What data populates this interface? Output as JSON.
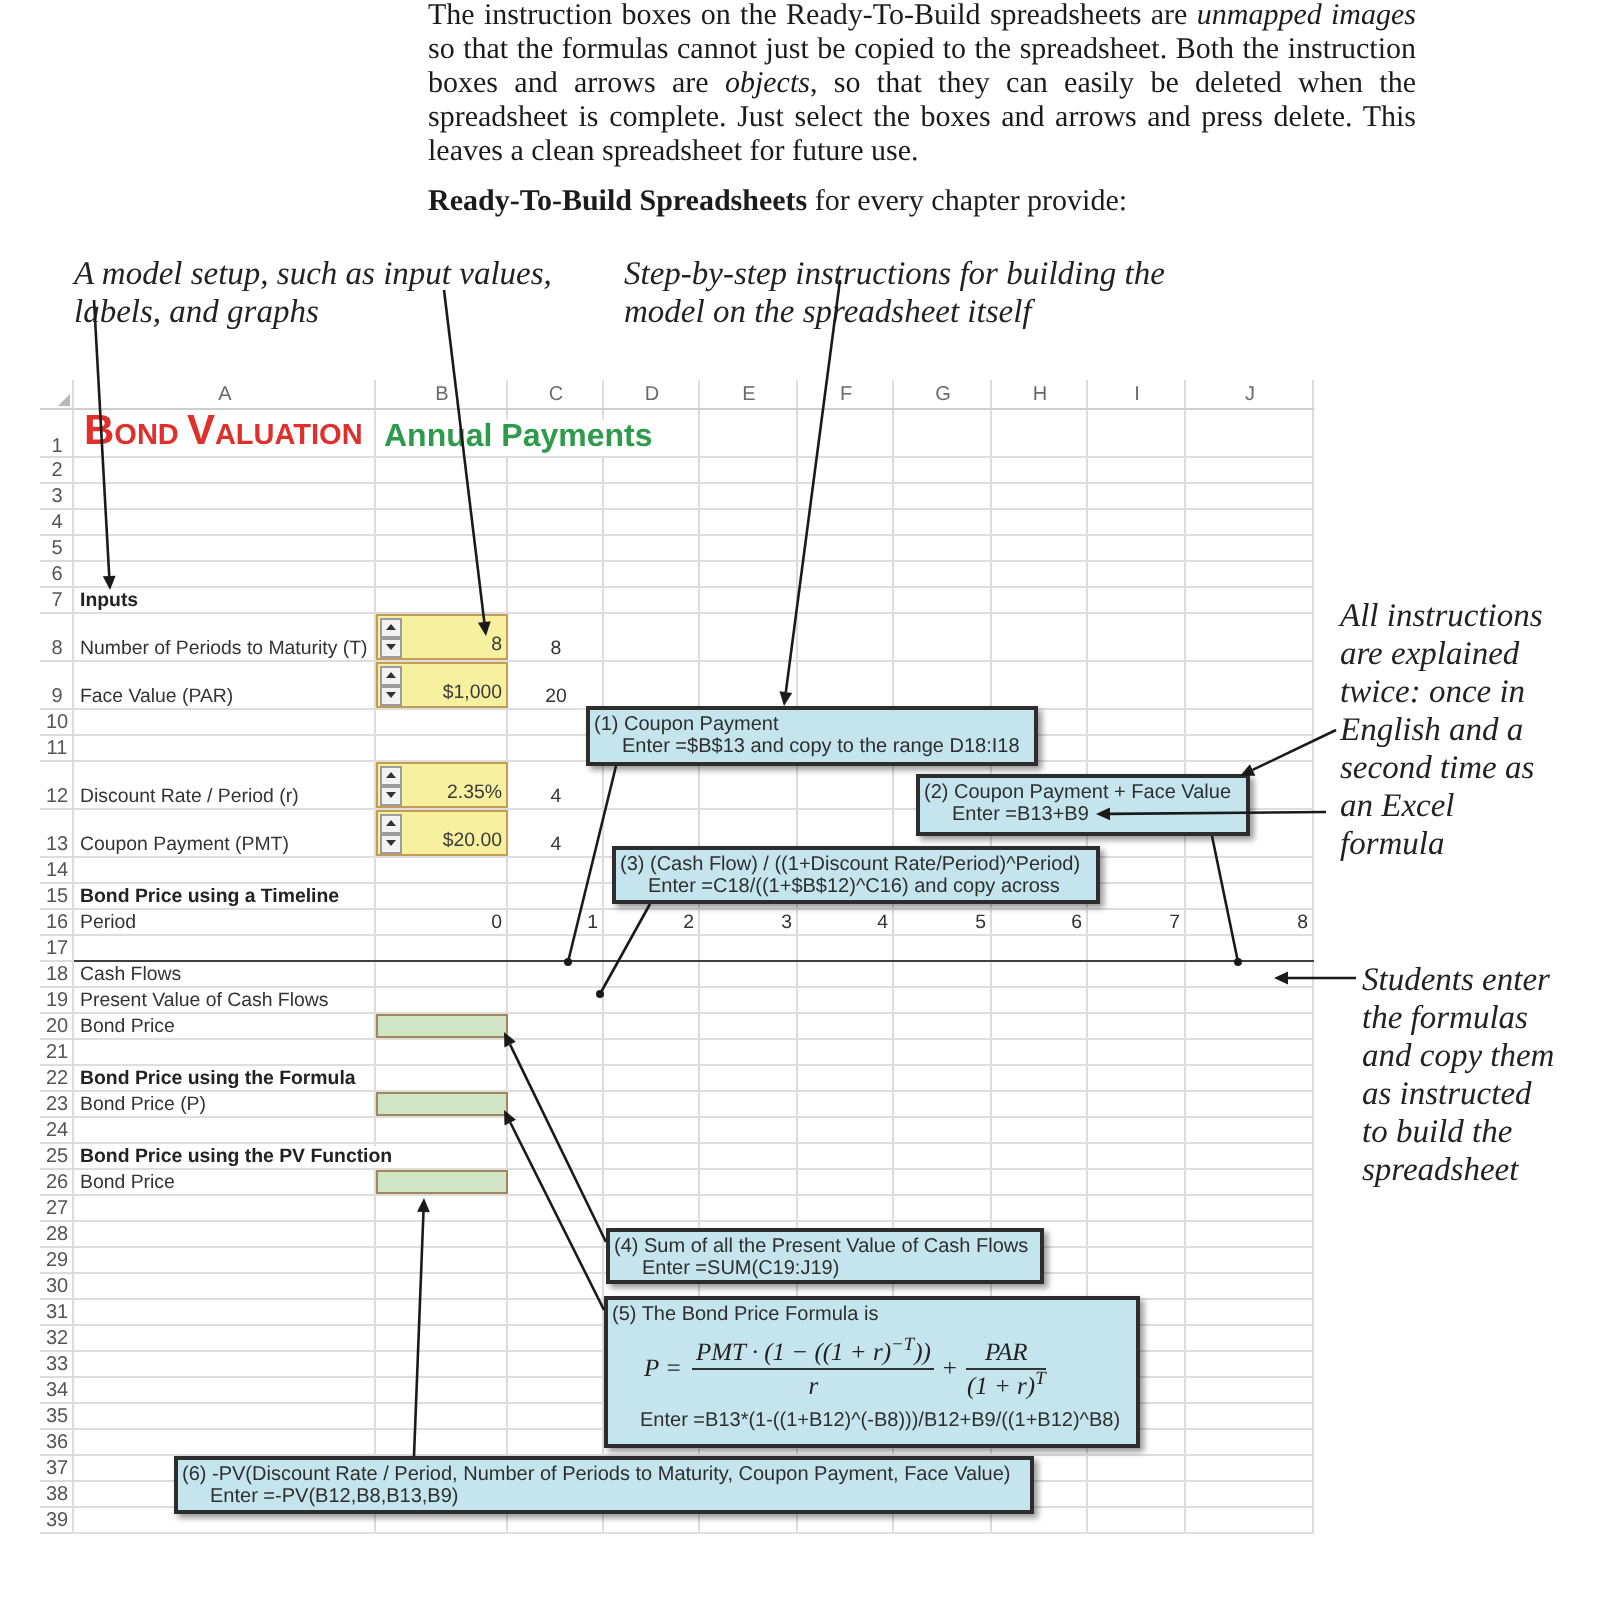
{
  "document": {
    "paragraph": "The instruction boxes on the Ready-To-Build spreadsheets are *unmapped images* so that the formulas cannot just be copied to the spreadsheet. Both the instruction boxes and arrows are *objects*, so that they can easily be deleted when the spreadsheet is complete. Just select the boxes and arrows and press delete. This leaves a clean spreadsheet for future use.",
    "lead_in": "**Ready-To-Build Spreadsheets** for every chapter provide:"
  },
  "callouts_top": [
    "A model setup, such as input values, labels, and graphs",
    "Step-by-step instructions for building the model on the spreadsheet itself"
  ],
  "callouts_side": [
    "All instructions are explained twice: once in English and a second time as an Excel formula",
    "Students enter the formulas and copy them as instructed to build the spreadsheet"
  ],
  "spreadsheet": {
    "columns": [
      "A",
      "B",
      "C",
      "D",
      "E",
      "F",
      "G",
      "H",
      "I",
      "J"
    ],
    "rows": [
      {
        "number": "1",
        "rule_below": false,
        "cells": [
          {
            "kind": "title",
            "text": "BOND VALUATION",
            "color": "#e0302c"
          },
          {
            "kind": "subtitle",
            "text": "Annual Payments",
            "color": "#2e9a4c"
          }
        ]
      },
      {
        "number": "2",
        "rule_below": false
      },
      {
        "number": "3",
        "rule_below": false
      },
      {
        "number": "4",
        "rule_below": false
      },
      {
        "number": "5",
        "rule_below": false
      },
      {
        "number": "6",
        "rule_below": false
      },
      {
        "number": "7",
        "rule_below": false,
        "cells": [
          {
            "kind": "heading",
            "text": "Inputs"
          }
        ]
      },
      {
        "number": "8",
        "rule_below": false,
        "cells": [
          {
            "kind": "label",
            "text": "Number of Periods to Maturity (T)"
          },
          {
            "kind": "spinner",
            "value": "8"
          },
          {
            "kind": "value",
            "text": "8"
          }
        ]
      },
      {
        "number": "9",
        "rule_below": false,
        "cells": [
          {
            "kind": "label",
            "text": "Face Value (PAR)"
          },
          {
            "kind": "spinner",
            "value": "$1,000"
          },
          {
            "kind": "value",
            "text": "20"
          }
        ]
      },
      {
        "number": "10",
        "rule_below": false
      },
      {
        "number": "11",
        "rule_below": false
      },
      {
        "number": "12",
        "rule_below": false,
        "cells": [
          {
            "kind": "label",
            "text": "Discount Rate / Period (r)"
          },
          {
            "kind": "spinner",
            "value": "2.35%"
          },
          {
            "kind": "value",
            "text": "4"
          }
        ]
      },
      {
        "number": "13",
        "rule_below": false,
        "cells": [
          {
            "kind": "label",
            "text": "Coupon Payment (PMT)"
          },
          {
            "kind": "spinner",
            "value": "$20.00"
          },
          {
            "kind": "value",
            "text": "4"
          }
        ]
      },
      {
        "number": "14",
        "rule_below": false
      },
      {
        "number": "15",
        "rule_below": false,
        "cells": [
          {
            "kind": "heading",
            "text": "Bond Price using a Timeline"
          }
        ]
      },
      {
        "number": "16",
        "rule_below": false,
        "cells": [
          {
            "kind": "label",
            "text": "Period"
          },
          {
            "kind": "number",
            "text": "0"
          },
          {
            "kind": "number",
            "text": "1"
          },
          {
            "kind": "number",
            "text": "2"
          },
          {
            "kind": "number",
            "text": "3"
          },
          {
            "kind": "number",
            "text": "4"
          },
          {
            "kind": "number",
            "text": "5"
          },
          {
            "kind": "number",
            "text": "6"
          },
          {
            "kind": "number",
            "text": "7"
          },
          {
            "kind": "number",
            "text": "8"
          }
        ]
      },
      {
        "number": "17",
        "rule_below": true
      },
      {
        "number": "18",
        "rule_below": false,
        "cells": [
          {
            "kind": "label",
            "text": "Cash Flows"
          }
        ]
      },
      {
        "number": "19",
        "rule_below": false,
        "cells": [
          {
            "kind": "label",
            "text": "Present Value of Cash Flows"
          }
        ]
      },
      {
        "number": "20",
        "rule_below": false,
        "cells": [
          {
            "kind": "label",
            "text": "Bond Price"
          },
          {
            "kind": "answer"
          }
        ]
      },
      {
        "number": "21",
        "rule_below": false
      },
      {
        "number": "22",
        "rule_below": false,
        "cells": [
          {
            "kind": "heading",
            "text": "Bond Price using the Formula"
          }
        ]
      },
      {
        "number": "23",
        "rule_below": false,
        "cells": [
          {
            "kind": "label",
            "text": "Bond Price (P)"
          },
          {
            "kind": "answer"
          }
        ]
      },
      {
        "number": "24",
        "rule_below": false
      },
      {
        "number": "25",
        "rule_below": false,
        "cells": [
          {
            "kind": "heading",
            "text": "Bond Price using the PV Function"
          }
        ]
      },
      {
        "number": "26",
        "rule_below": false,
        "cells": [
          {
            "kind": "label",
            "text": "Bond Price"
          },
          {
            "kind": "answer"
          }
        ]
      },
      {
        "number": "27",
        "rule_below": false
      },
      {
        "number": "28",
        "rule_below": false
      },
      {
        "number": "29",
        "rule_below": false
      },
      {
        "number": "30",
        "rule_below": false
      },
      {
        "number": "31",
        "rule_below": false
      },
      {
        "number": "32",
        "rule_below": false
      },
      {
        "number": "33",
        "rule_below": false
      },
      {
        "number": "34",
        "rule_below": false
      },
      {
        "number": "35",
        "rule_below": false
      },
      {
        "number": "36",
        "rule_below": false
      },
      {
        "number": "37",
        "rule_below": false
      },
      {
        "number": "38",
        "rule_below": false
      },
      {
        "number": "39",
        "rule_below": false
      }
    ]
  },
  "instruction_boxes": [
    {
      "title": "(1) Coupon Payment",
      "formula": "Enter =$B$13 and copy to the range D18:I18"
    },
    {
      "title": "(2) Coupon Payment + Face Value",
      "formula": "Enter =B13+B9"
    },
    {
      "title": "(3) (Cash Flow) / ((1+Discount Rate/Period)^Period)",
      "formula": "Enter =C18/((1+$B$12)^C16) and copy across"
    },
    {
      "title": "(4) Sum of all the Present Value of Cash Flows",
      "formula": "Enter =SUM(C19:J19)"
    },
    {
      "title": "(5) The Bond Price Formula is",
      "equation": {
        "lhs": "P =",
        "operator": "+",
        "terms": [
          {
            "numerator": "PMT · (1 − ((1 + r)$^{−T}$))",
            "denominator": "r"
          },
          {
            "numerator": "PAR",
            "denominator": "(1 + r)$^{T}$"
          }
        ]
      },
      "formula": "Enter =B13*(1-((1+B12)^(-B8)))/B12+B9/((1+B12)^B8)"
    },
    {
      "title": "(6) -PV(Discount Rate / Period, Number of Periods to Maturity, Coupon Payment, Face Value)",
      "formula": "Enter =-PV(B12,B8,B13,B9)"
    }
  ]
}
